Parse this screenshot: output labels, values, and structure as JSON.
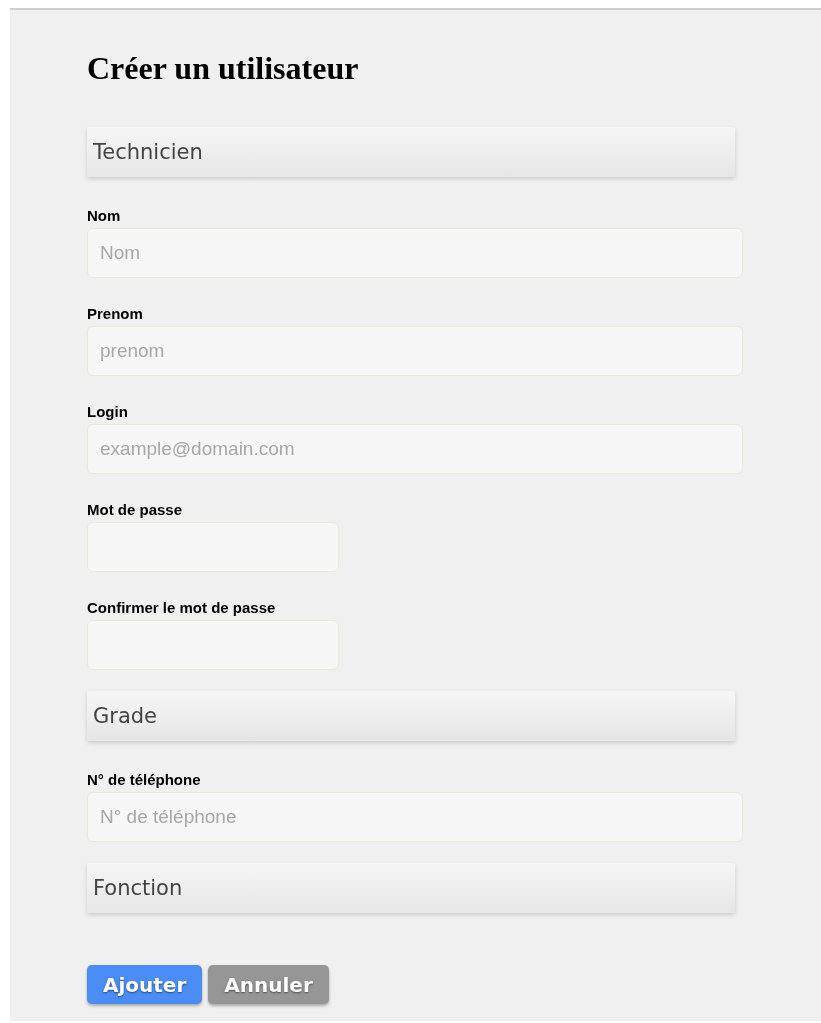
{
  "title": "Créer un utilisateur",
  "items": [
    {
      "kind": "select",
      "value": "Technicien"
    },
    {
      "kind": "field",
      "label": "Nom",
      "placeholder": "Nom"
    },
    {
      "kind": "field",
      "label": "Prenom",
      "placeholder": "prenom"
    },
    {
      "kind": "field",
      "label": "Login",
      "placeholder": "example@domain.com"
    },
    {
      "kind": "password",
      "label": "Mot de passe"
    },
    {
      "kind": "password",
      "label": "Confirmer le mot de passe"
    },
    {
      "kind": "select",
      "value": "Grade"
    },
    {
      "kind": "field",
      "label": "N° de téléphone",
      "placeholder": "N° de téléphone"
    },
    {
      "kind": "select",
      "value": "Fonction"
    }
  ],
  "buttons": [
    {
      "label": "Ajouter",
      "kind": "primary"
    },
    {
      "label": "Annuler",
      "kind": "secondary"
    }
  ]
}
